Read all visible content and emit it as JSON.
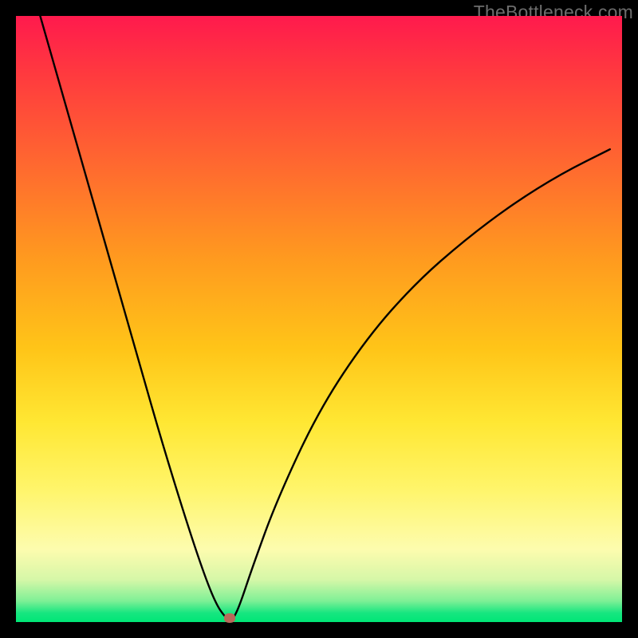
{
  "watermark": "TheBottleneck.com",
  "chart_data": {
    "type": "line",
    "title": "",
    "xlabel": "",
    "ylabel": "",
    "xlim": [
      0,
      100
    ],
    "ylim": [
      0,
      100
    ],
    "grid": false,
    "legend": false,
    "background": "heatmap-gradient",
    "series": [
      {
        "name": "bottleneck-curve",
        "x": [
          4,
          8,
          12,
          16,
          20,
          24,
          28,
          31,
          33,
          34.5,
          35.5,
          36,
          37,
          39,
          43,
          50,
          58,
          66,
          74,
          82,
          90,
          98
        ],
        "y": [
          100,
          86,
          72,
          58,
          44,
          30,
          17,
          8,
          3,
          0.8,
          0.2,
          0.8,
          3,
          9,
          20,
          35,
          47,
          56,
          63,
          69,
          74,
          78
        ]
      }
    ],
    "marker": {
      "x": 35.3,
      "y": 0.6,
      "color": "#b86a5a"
    },
    "gradient_stops": [
      {
        "pos": 0,
        "color": "#ff1a4d"
      },
      {
        "pos": 0.4,
        "color": "#ff9a1f"
      },
      {
        "pos": 0.67,
        "color": "#ffe733"
      },
      {
        "pos": 0.93,
        "color": "#d6f7a8"
      },
      {
        "pos": 1.0,
        "color": "#00e676"
      }
    ]
  }
}
